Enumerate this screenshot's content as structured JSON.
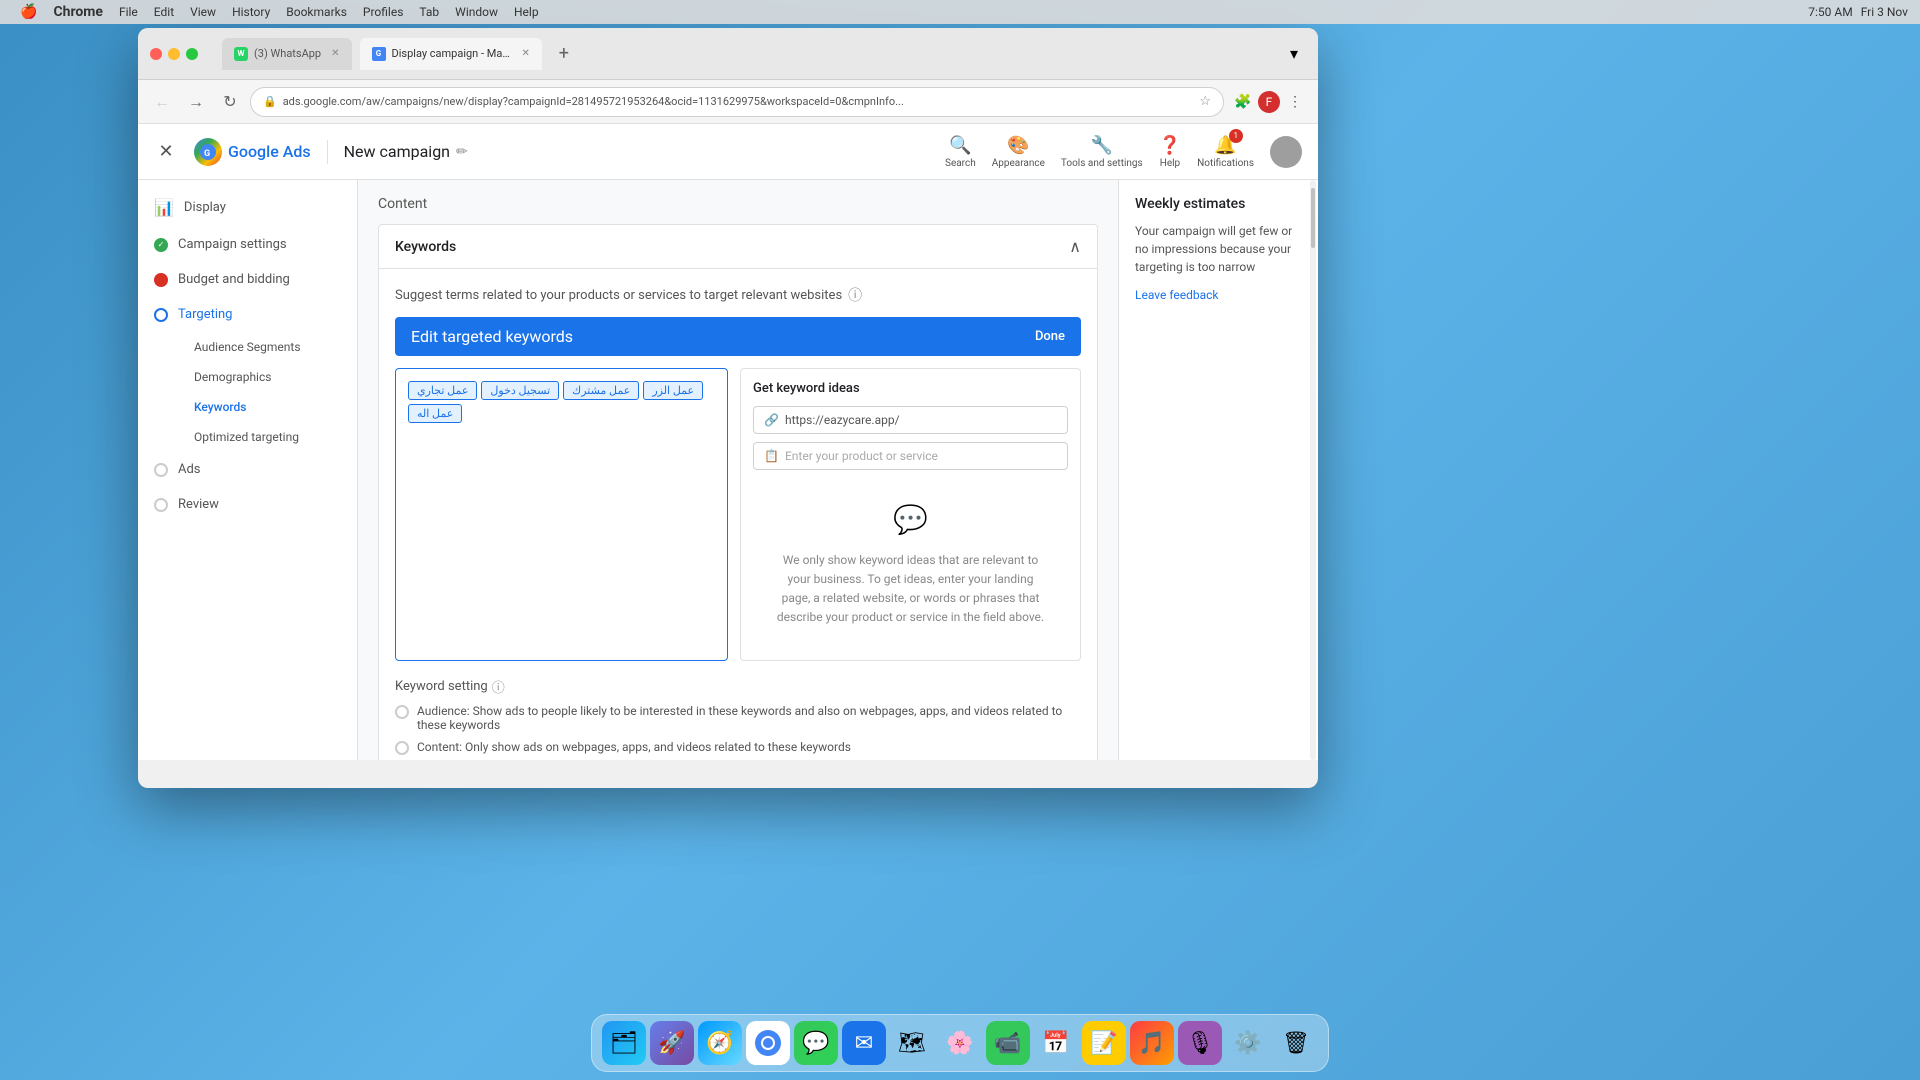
{
  "macMenubar": {
    "apple": "🍎",
    "items": [
      "Chrome",
      "File",
      "Edit",
      "View",
      "History",
      "Bookmarks",
      "Profiles",
      "Tab",
      "Window",
      "Help"
    ],
    "right": {
      "time": "7:50 AM",
      "date": "Fri 3 Nov"
    }
  },
  "tabs": [
    {
      "id": "whatsapp",
      "label": "(3) WhatsApp",
      "active": false,
      "icon": "whatsapp"
    },
    {
      "id": "display-campaign",
      "label": "Display campaign - Main acc...",
      "active": true,
      "icon": "google-ads"
    }
  ],
  "addressBar": {
    "url": "ads.google.com/aw/campaigns/new/display?campaignId=281495721953264&ocid=1131629975&workspaceId=0&cmpnInfo..."
  },
  "appHeader": {
    "title": "New campaign",
    "logoText": "Google Ads",
    "closeLabel": "✕",
    "actions": [
      {
        "id": "search",
        "icon": "🔍",
        "label": "Search"
      },
      {
        "id": "appearance",
        "icon": "🎨",
        "label": "Appearance"
      },
      {
        "id": "tools",
        "icon": "🔧",
        "label": "Tools and settings"
      },
      {
        "id": "help",
        "icon": "❓",
        "label": "Help"
      },
      {
        "id": "notifications",
        "icon": "🔔",
        "label": "Notifications",
        "badge": "1"
      }
    ]
  },
  "sidebar": {
    "items": [
      {
        "id": "display",
        "label": "Display",
        "status": "icon",
        "icon": "📊"
      },
      {
        "id": "campaign-settings",
        "label": "Campaign settings",
        "status": "complete"
      },
      {
        "id": "budget-bidding",
        "label": "Budget and bidding",
        "status": "error"
      },
      {
        "id": "targeting",
        "label": "Targeting",
        "status": "active"
      },
      {
        "id": "ads",
        "label": "Ads",
        "status": "pending"
      },
      {
        "id": "review",
        "label": "Review",
        "status": "pending"
      }
    ],
    "subItems": [
      {
        "id": "audience-segments",
        "label": "Audience Segments"
      },
      {
        "id": "demographics",
        "label": "Demographics"
      },
      {
        "id": "keywords",
        "label": "Keywords",
        "active": true
      },
      {
        "id": "optimized-targeting",
        "label": "Optimized targeting"
      }
    ]
  },
  "main": {
    "contentHeader": "Content",
    "keywords": {
      "title": "Keywords",
      "hint": "Suggest terms related to your products or services to target relevant websites",
      "editBar": {
        "label": "Edit targeted keywords",
        "doneLabel": "Done"
      },
      "chips": [
        "عمل تجاري",
        "تسجيل دخول",
        "عمل مشترك",
        "عمل الزر",
        "عمل اله"
      ],
      "ideas": {
        "title": "Get keyword ideas",
        "urlPlaceholder": "https://eazycare.app/",
        "productPlaceholder": "Enter your product or service",
        "emptyText": "We only show keyword ideas that are relevant to your business. To get ideas, enter your landing page, a related website, or words or phrases that describe your product or service in the field above."
      },
      "setting": {
        "title": "Keyword setting",
        "options": [
          {
            "id": "audience",
            "label": "Audience: Show ads to people likely to be interested in these keywords and also on webpages, apps, and videos related to these keywords"
          },
          {
            "id": "content",
            "label": "Content: Only show ads on webpages, apps, and videos related to these keywords"
          }
        ]
      }
    }
  },
  "weeklyEstimates": {
    "title": "Weekly estimates",
    "text": "Your campaign will get few or no impressions because your targeting is too narrow",
    "feedbackLabel": "Leave feedback"
  },
  "dock": {
    "items": [
      {
        "id": "finder",
        "icon": "🗂",
        "color": "#2196f3"
      },
      {
        "id": "launchpad",
        "icon": "🚀",
        "color": "#ff6b6b"
      },
      {
        "id": "safari",
        "icon": "🧭",
        "color": "#0099ff"
      },
      {
        "id": "chrome",
        "icon": "🌐",
        "color": "#4285f4"
      },
      {
        "id": "messages",
        "icon": "💬",
        "color": "#34c759"
      },
      {
        "id": "mail",
        "icon": "✉️",
        "color": "#1a73e8"
      },
      {
        "id": "maps",
        "icon": "🗺",
        "color": "#34a853"
      },
      {
        "id": "photos",
        "icon": "🖼",
        "color": "#ff6b6b"
      },
      {
        "id": "facetime",
        "icon": "📹",
        "color": "#34c759"
      },
      {
        "id": "calendar",
        "icon": "📅",
        "color": "#ff3b30"
      },
      {
        "id": "notes-app",
        "icon": "📝",
        "color": "#ffcc00"
      },
      {
        "id": "music",
        "icon": "🎵",
        "color": "#fc3c44"
      },
      {
        "id": "podcasts",
        "icon": "🎙",
        "color": "#9b59b6"
      },
      {
        "id": "system-prefs",
        "icon": "⚙️",
        "color": "#888"
      },
      {
        "id": "trash",
        "icon": "🗑",
        "color": "#888"
      }
    ]
  }
}
